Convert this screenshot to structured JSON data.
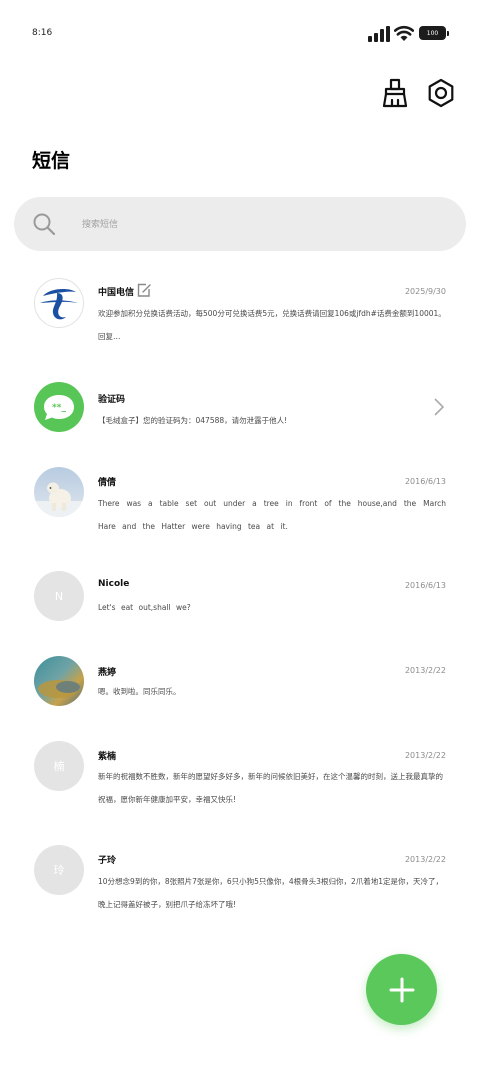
{
  "status_bar": {
    "time": "8:16",
    "battery": "100"
  },
  "top_actions": {
    "clean_icon": "broom-icon",
    "settings_icon": "settings-hex-icon"
  },
  "page": {
    "title": "短信"
  },
  "search": {
    "placeholder": "搜索短信"
  },
  "messages": [
    {
      "name": "中国电信",
      "date": "2025/9/30",
      "preview": "欢迎参加积分兑换话费活动，每500分可兑换话费5元，兑换话费请回复106或jfdh#话费金额到10001。回复…",
      "avatar": "china-telecom-logo",
      "badge_icon": "edit-icon"
    },
    {
      "name": "验证码",
      "date": "",
      "preview": "【毛绒盒子】您的验证码为：047588，请勿泄露于他人!",
      "avatar": "verification-code-icon",
      "trailing_icon": "chevron-right-icon"
    },
    {
      "name": "倩倩",
      "date": "2016/6/13",
      "preview": "There was a table set out under a tree in front of the house,and the March Hare and the Hatter were having tea at it.",
      "avatar": "polar-bear-photo"
    },
    {
      "name": "Nicole",
      "date": "2016/6/13",
      "preview": "Let's eat out,shall we?",
      "avatar_letter": "N"
    },
    {
      "name": "燕婷",
      "date": "2013/2/22",
      "preview": "嗯。收到啦。同乐同乐。",
      "avatar": "landscape-photo"
    },
    {
      "name": "紫楠",
      "date": "2013/2/22",
      "preview": "新年的祝福数不胜数，新年的愿望好多好多，新年的问候依旧美好，在这个温馨的时刻，送上我最真挚的祝福，愿你新年健康加平安，幸福又快乐!",
      "avatar_letter": "楠"
    },
    {
      "name": "子玲",
      "date": "2013/2/22",
      "preview": "10分想念9到的你，8张照片7张是你，6只小狗5只像你，4根骨头3根归你，2爪着地1定是你，天冷了，晚上记得盖好被子，别把爪子给冻坏了哦!",
      "avatar_letter": "玲"
    }
  ],
  "fab": {
    "icon": "plus-icon",
    "color": "#5ac85a"
  },
  "colors": {
    "accent": "#5ac85a",
    "telecom_blue": "#1b4fa1",
    "search_bg": "#ececec"
  }
}
